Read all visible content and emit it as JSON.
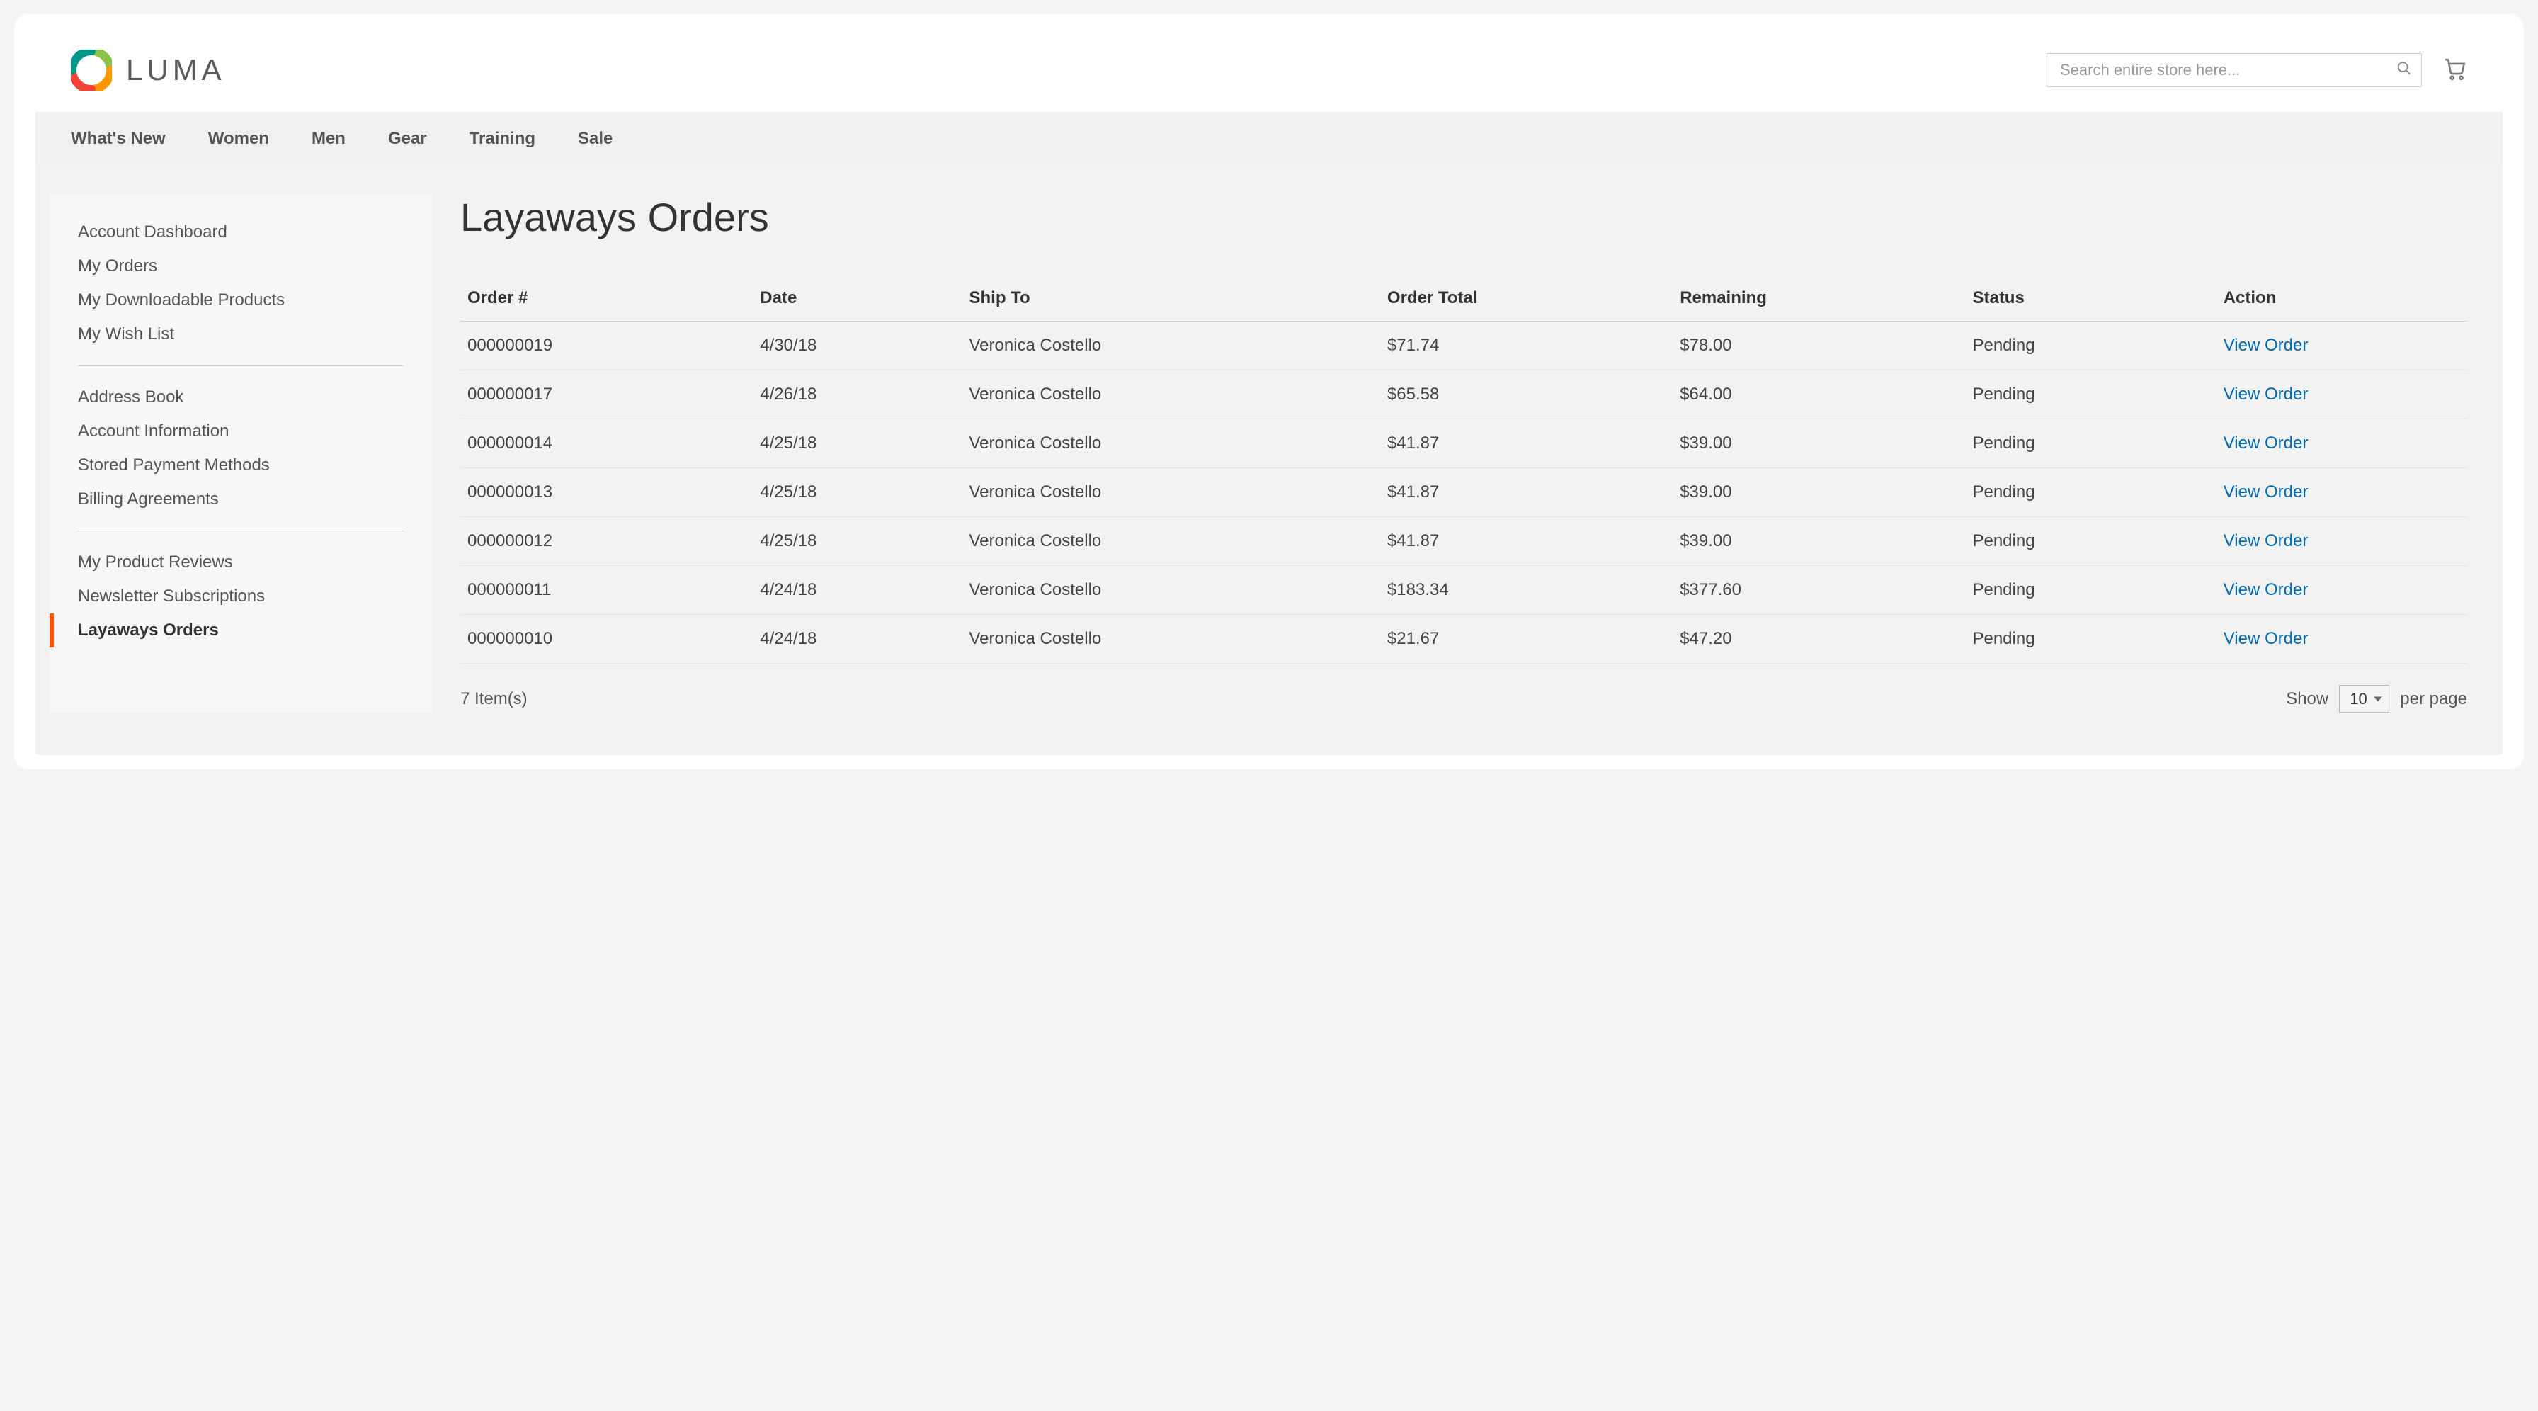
{
  "brand": {
    "name": "LUMA"
  },
  "search": {
    "placeholder": "Search entire store here..."
  },
  "nav": {
    "items": [
      "What's New",
      "Women",
      "Men",
      "Gear",
      "Training",
      "Sale"
    ]
  },
  "sidebar": {
    "groups": [
      [
        "Account Dashboard",
        "My Orders",
        "My Downloadable Products",
        "My Wish List"
      ],
      [
        "Address Book",
        "Account Information",
        "Stored Payment Methods",
        "Billing Agreements"
      ],
      [
        "My Product Reviews",
        "Newsletter Subscriptions",
        "Layaways Orders"
      ]
    ],
    "active": "Layaways Orders"
  },
  "page": {
    "title": "Layaways Orders"
  },
  "table": {
    "headers": [
      "Order #",
      "Date",
      "Ship To",
      "Order Total",
      "Remaining",
      "Status",
      "Action"
    ],
    "rows": [
      {
        "order_no": "000000019",
        "date": "4/30/18",
        "ship_to": "Veronica Costello",
        "order_total": "$71.74",
        "remaining": "$78.00",
        "status": "Pending",
        "action": "View Order"
      },
      {
        "order_no": "000000017",
        "date": "4/26/18",
        "ship_to": "Veronica Costello",
        "order_total": "$65.58",
        "remaining": "$64.00",
        "status": "Pending",
        "action": "View Order"
      },
      {
        "order_no": "000000014",
        "date": "4/25/18",
        "ship_to": "Veronica Costello",
        "order_total": "$41.87",
        "remaining": "$39.00",
        "status": "Pending",
        "action": "View Order"
      },
      {
        "order_no": "000000013",
        "date": "4/25/18",
        "ship_to": "Veronica Costello",
        "order_total": "$41.87",
        "remaining": "$39.00",
        "status": "Pending",
        "action": "View Order"
      },
      {
        "order_no": "000000012",
        "date": "4/25/18",
        "ship_to": "Veronica Costello",
        "order_total": "$41.87",
        "remaining": "$39.00",
        "status": "Pending",
        "action": "View Order"
      },
      {
        "order_no": "000000011",
        "date": "4/24/18",
        "ship_to": "Veronica Costello",
        "order_total": "$183.34",
        "remaining": "$377.60",
        "status": "Pending",
        "action": "View Order"
      },
      {
        "order_no": "000000010",
        "date": "4/24/18",
        "ship_to": "Veronica Costello",
        "order_total": "$21.67",
        "remaining": "$47.20",
        "status": "Pending",
        "action": "View Order"
      }
    ]
  },
  "footer": {
    "count_text": "7 Item(s)",
    "show_label": "Show",
    "per_page_label": "per page",
    "page_size": "10"
  }
}
